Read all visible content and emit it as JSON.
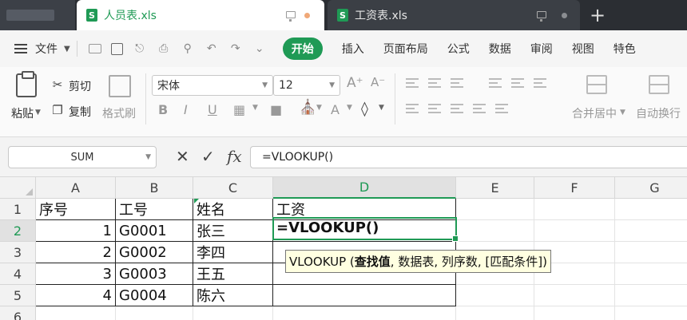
{
  "tabs": [
    {
      "label": "人员表.xls",
      "active": true
    },
    {
      "label": "工资表.xls",
      "active": false
    }
  ],
  "menubar": {
    "file": "文件",
    "items": [
      "开始",
      "插入",
      "页面布局",
      "公式",
      "数据",
      "审阅",
      "视图",
      "特色"
    ]
  },
  "ribbon": {
    "paste": "粘贴",
    "cut": "剪切",
    "copy": "复制",
    "format_painter": "格式刷",
    "font_name": "宋体",
    "font_size": "12",
    "merge_center": "合并居中",
    "wrap_text": "自动换行"
  },
  "formula_bar": {
    "name_box": "SUM",
    "fx": "fx",
    "formula": "=VLOOKUP()"
  },
  "grid": {
    "columns": [
      "A",
      "B",
      "C",
      "D",
      "E",
      "F",
      "G"
    ],
    "rows": [
      "1",
      "2",
      "3",
      "4",
      "5",
      "6"
    ],
    "header_row": {
      "A": "序号",
      "B": "工号",
      "C": "姓名",
      "D": "工资"
    },
    "data": [
      {
        "A": "1",
        "B": "G0001",
        "C": "张三"
      },
      {
        "A": "2",
        "B": "G0002",
        "C": "李四"
      },
      {
        "A": "3",
        "B": "G0003",
        "C": "王五"
      },
      {
        "A": "4",
        "B": "G0004",
        "C": "陈六"
      }
    ],
    "active_cell_text": "=VLOOKUP()"
  },
  "tooltip": {
    "prefix": "VLOOKUP (",
    "bold": "查找值",
    "rest": ", 数据表, 列序数, [匹配条件])"
  },
  "colors": {
    "accent": "#1f9a55",
    "tab_bar": "#2b2e33",
    "tooltip_bg": "#ffffe1"
  }
}
